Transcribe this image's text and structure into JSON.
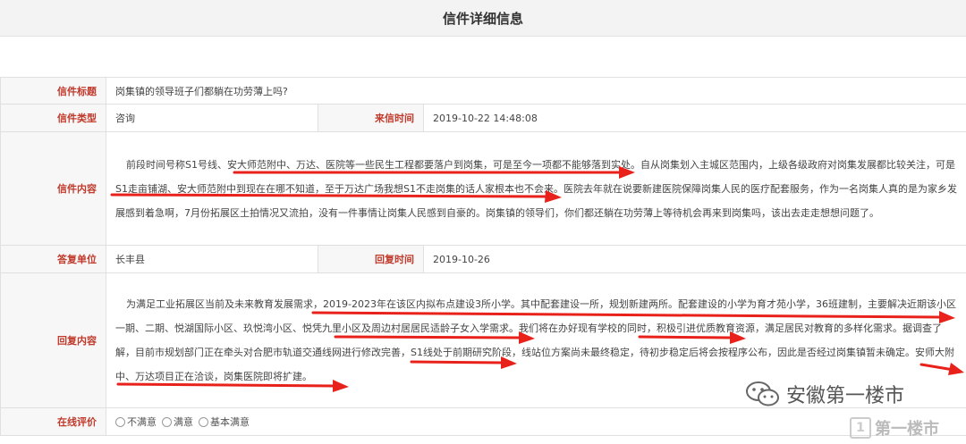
{
  "page": {
    "title": "信件详细信息"
  },
  "letter": {
    "title_label": "信件标题",
    "title_value": "岗集镇的领导班子们都躺在功劳薄上吗?",
    "type_label": "信件类型",
    "type_value": "咨询",
    "time_label": "来信时间",
    "time_value": "2019-10-22 14:48:08",
    "content_label": "信件内容",
    "content_value": "前段时间号称S1号线、安大师范附中、万达、医院等一些民生工程都要落户到岗集，可是至今一项都不能够落到实处。自从岗集划入主城区范围内，上级各级政府对岗集发展都比较关注，可是S1走亩铺湖、安大师范附中到现在在哪不知道，至于万达广场我想S1不走岗集的话人家根本也不会来。医院去年就在说要新建医院保障岗集人民的医疗配套服务，作为一名岗集人真的是为家乡发展感到着急啊，7月份拓展区土拍情况又流拍，没有一件事情让岗集人民感到自豪的。岗集镇的领导们，你们都还躺在功劳薄上等待机会再来到岗集吗，该出去走走想想问题了。"
  },
  "reply": {
    "unit_label": "答复单位",
    "unit_value": "长丰县",
    "time_label": "回复时间",
    "time_value": "2019-10-26",
    "content_label": "回复内容",
    "content_value": "为满足工业拓展区当前及未来教育发展需求，2019-2023年在该区内拟布点建设3所小学。其中配套建设一所，规划新建两所。配套建设的小学为育才苑小学，36班建制，主要解决近期该小区一期、二期、悦湖国际小区、玖悦湾小区、悦凭九里小区及周边村居居民适龄子女入学需求。我们将在办好现有学校的同时，积极引进优质教育资源，满足居民对教育的多样化需求。据调查了解，目前市规划部门正在牵头对合肥市轨道交通线网进行修改完善，S1线处于前期研究阶段，线站位方案尚未最终稳定，待初步稳定后将会按程序公布，因此是否经过岗集镇暂未确定。安师大附中、万达项目正在洽谈，岗集医院即将扩建。"
  },
  "evaluation": {
    "label": "在线评价",
    "options": [
      "不满意",
      "满意",
      "基本满意"
    ]
  },
  "watermark": {
    "account": "安徽第一楼市",
    "badge_char": "1",
    "brand": "第一楼市"
  },
  "colors": {
    "label_red": "#c0392b",
    "annotation_red": "#e8221b"
  }
}
